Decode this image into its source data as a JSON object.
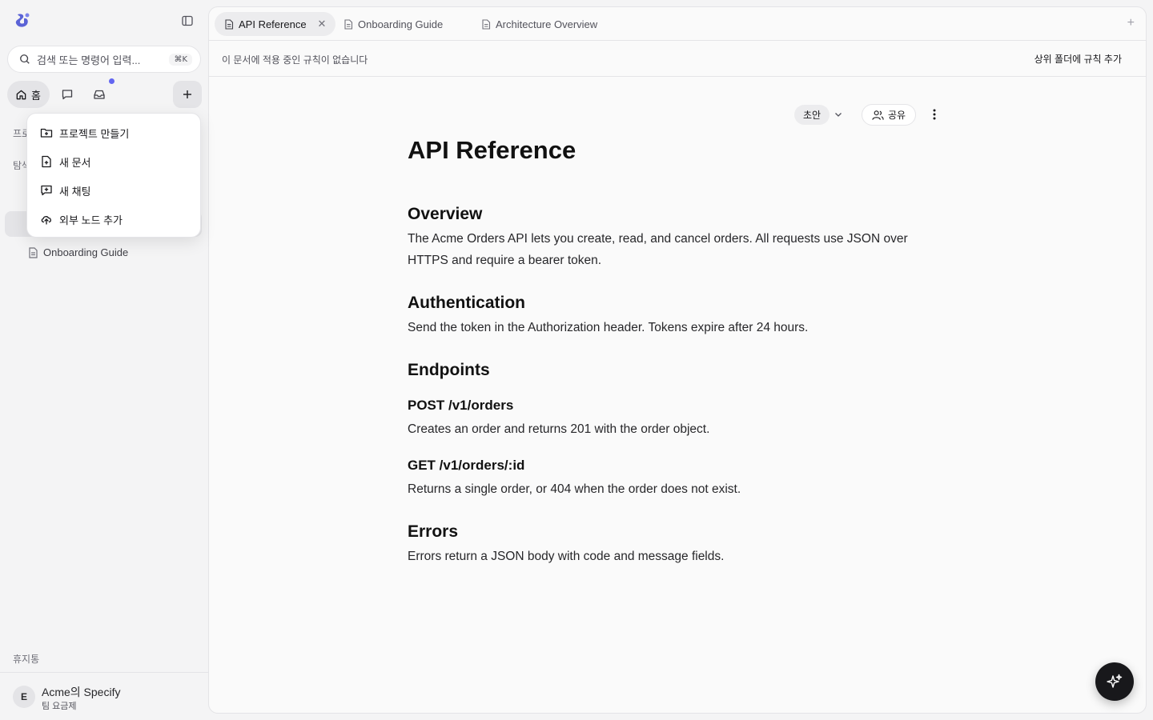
{
  "sidebar": {
    "search": {
      "placeholder": "검색 또는 명령어 입력...",
      "shortcut": "⌘K"
    },
    "nav": {
      "home_label": "홈",
      "notification_dot": true
    },
    "section_labels": {
      "projects": "프로",
      "explore": "탐색"
    },
    "tree": [
      {
        "label": "Onboarding Guide",
        "icon": "document-icon"
      }
    ],
    "trash_label": "휴지통",
    "workspace": {
      "avatar_letter": "E",
      "name": "Acme의 Specify",
      "plan": "팀 요금제"
    }
  },
  "create_menu": {
    "items": [
      {
        "label": "프로젝트 만들기",
        "icon": "folder-plus-icon"
      },
      {
        "label": "새 문서",
        "icon": "file-plus-icon"
      },
      {
        "label": "새 채팅",
        "icon": "chat-plus-icon"
      },
      {
        "label": "외부 노드 추가",
        "icon": "cloud-upload-icon"
      }
    ]
  },
  "tabs": [
    {
      "label": "API Reference",
      "active": true
    },
    {
      "label": "Onboarding Guide",
      "active": false
    },
    {
      "label": "Architecture Overview",
      "active": false
    }
  ],
  "rules": {
    "message": "이 문서에 적용 중인 규칙이 없습니다",
    "action": "상위 폴더에 규칙 추가"
  },
  "doc_toolbar": {
    "status": "초안",
    "share_label": "공유"
  },
  "document": {
    "title": "API Reference",
    "sections": [
      {
        "heading": "Overview",
        "body": "The Acme Orders API lets you create, read, and cancel orders. All requests use JSON over HTTPS and require a bearer token."
      },
      {
        "heading": "Authentication",
        "body": "Send the token in the Authorization header. Tokens expire after 24 hours."
      },
      {
        "heading": "Endpoints"
      },
      {
        "subheading": "POST /v1/orders",
        "body": "Creates an order and returns 201 with the order object."
      },
      {
        "subheading": "GET /v1/orders/:id",
        "body": "Returns a single order, or 404 when the order does not exist."
      },
      {
        "heading": "Errors",
        "body": "Errors return a JSON body with code and message fields."
      }
    ]
  },
  "colors": {
    "accent": "#6366f1",
    "fab": "#18181b",
    "sidebar_bg": "#f4f4f5",
    "main_bg": "#fafafa"
  }
}
